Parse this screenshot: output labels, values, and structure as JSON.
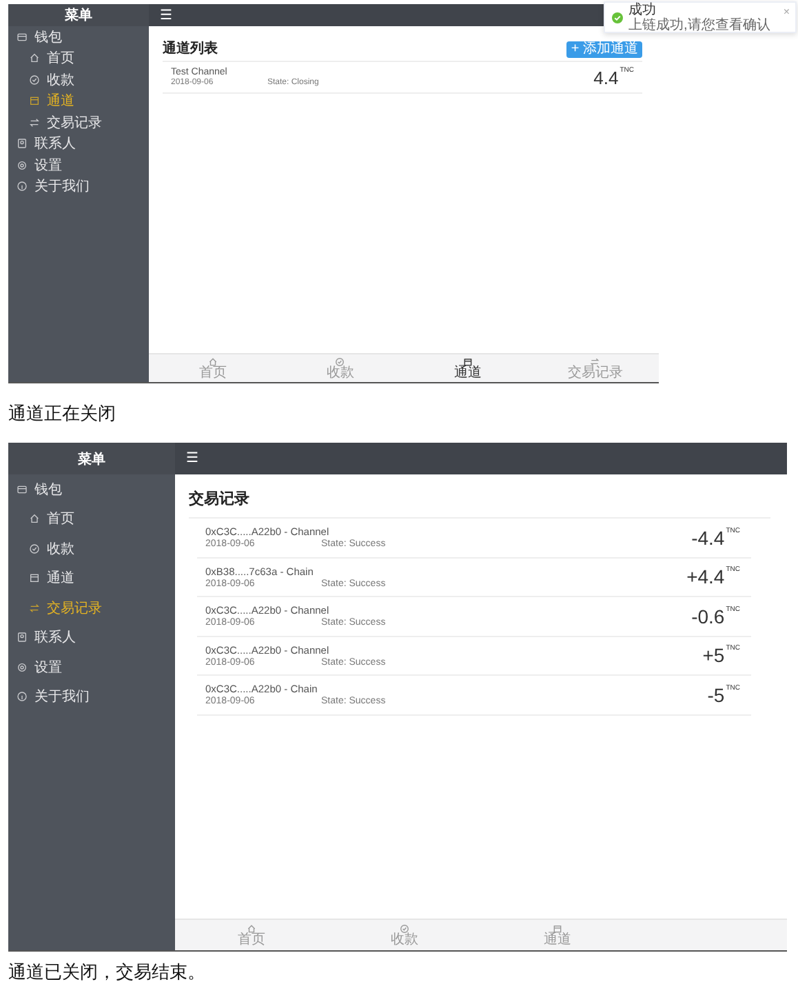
{
  "screens": [
    {
      "sidebar": {
        "title": "菜单",
        "items": [
          {
            "label": "钱包",
            "children": [
              {
                "label": "首页",
                "selected": false
              },
              {
                "label": "收款",
                "selected": false
              },
              {
                "label": "通道",
                "selected": true
              },
              {
                "label": "交易记录",
                "selected": false
              }
            ]
          },
          {
            "label": "联系人"
          },
          {
            "label": "设置"
          },
          {
            "label": "关于我们"
          }
        ]
      },
      "header_icon": "☰",
      "title": "通道列表",
      "add_button": "+ 添加通道",
      "rows": [
        {
          "name": "Test Channel",
          "date": "2018-09-06",
          "state": "State:  Closing",
          "amount": "4.4$^{TNC}$"
        }
      ],
      "tabs": [
        {
          "label": "首页",
          "selected": false
        },
        {
          "label": "收款",
          "selected": false
        },
        {
          "label": "通道",
          "selected": true
        },
        {
          "label": "交易记录",
          "selected": false
        }
      ],
      "toast": {
        "title": "成功",
        "message": "上链成功,请您查看确认",
        "close": "×"
      },
      "caption": "通道正在关闭"
    },
    {
      "sidebar": {
        "title": "菜单",
        "items": [
          {
            "label": "钱包",
            "children": [
              {
                "label": "首页",
                "selected": false
              },
              {
                "label": "收款",
                "selected": false
              },
              {
                "label": "通道",
                "selected": false
              },
              {
                "label": "交易记录",
                "selected": true
              }
            ]
          },
          {
            "label": "联系人"
          },
          {
            "label": "设置"
          },
          {
            "label": "关于我们"
          }
        ]
      },
      "header_icon": "☰",
      "title": "交易记录",
      "rows": [
        {
          "name": "0xC3C.....A22b0 - Channel",
          "date": "2018-09-06",
          "state": "State:  Success",
          "amount": "-4.4$^{TNC}$"
        },
        {
          "name": "0xB38.....7c63a - Chain",
          "date": "2018-09-06",
          "state": "State:  Success",
          "amount": "+4.4$^{TNC}$"
        },
        {
          "name": "0xC3C.....A22b0 - Channel",
          "date": "2018-09-06",
          "state": "State:  Success",
          "amount": "-0.6$^{TNC}$"
        },
        {
          "name": "0xC3C.....A22b0 - Channel",
          "date": "2018-09-06",
          "state": "State:  Success",
          "amount": "+5$^{TNC}$"
        },
        {
          "name": "0xC3C.....A22b0 - Chain",
          "date": "2018-09-06",
          "state": "State:  Success",
          "amount": "-5$^{TNC}$"
        }
      ],
      "tabs": [
        {
          "label": "首页",
          "selected": false
        },
        {
          "label": "收款",
          "selected": false
        },
        {
          "label": "通道",
          "selected": false
        }
      ],
      "caption": "通道已关闭，交易结束。"
    }
  ]
}
